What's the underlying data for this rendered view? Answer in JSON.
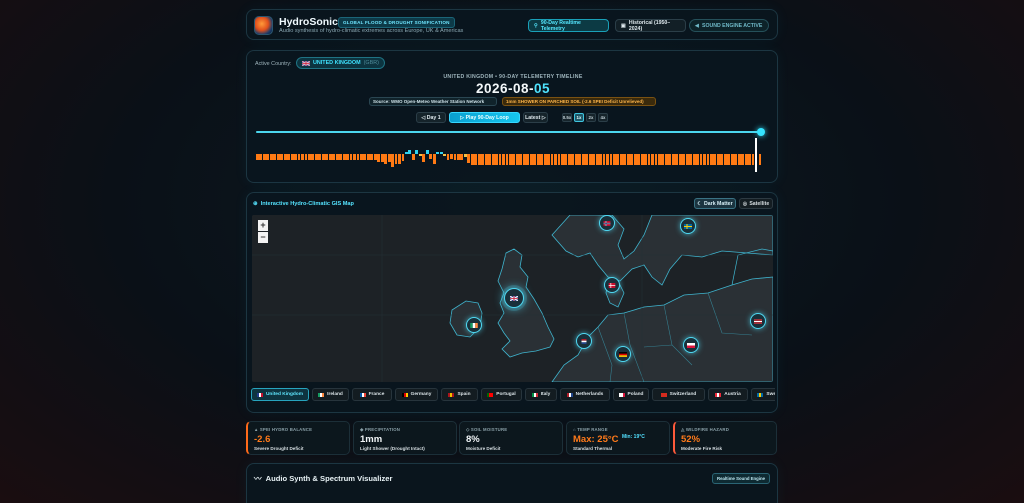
{
  "header": {
    "title": "HydroSonics",
    "badge": "GLOBAL FLOOD & DROUGHT SONIFICATION",
    "subtitle": "Audio synthesis of hydro-climatic extremes across Europe, UK & Americas",
    "btn_telemetry": "90-Day Realtime Telemetry",
    "btn_historical": "Historical (1950–2024)",
    "btn_sound": "SOUND ENGINE ACTIVE"
  },
  "timeline": {
    "active_label": "Active Country:",
    "active_country": "UNITED KINGDOM",
    "active_code": "(GBR)",
    "subtitle": "UNITED KINGDOM • 90-DAY TELEMETRY TIMELINE",
    "date_prefix": "2026-08-",
    "date_day": "05",
    "source": "Source: WMO Open-Meteo Weather Station Network",
    "status": "1mm SHOWER ON PARCHED SOIL (-2.6 SPEI Deficit Unrelieved)",
    "btn_day1": "Day 1",
    "btn_play": "Play 90-Day Loop",
    "btn_latest": "Latest",
    "speeds": [
      "0.5x",
      "1x",
      "2x",
      "4x"
    ],
    "active_speed": "1x",
    "position_fraction": 0.995,
    "bars": [
      -1,
      -1,
      -1,
      -1,
      -1,
      -1,
      -1,
      -1,
      -1,
      -1,
      -1,
      -1,
      -1,
      -1,
      -1,
      -1,
      -1,
      -1,
      -1,
      -1,
      -1,
      -1,
      -1,
      -1,
      -1,
      -1,
      -1,
      -1,
      -1,
      -1,
      -1,
      -1,
      -1,
      -1,
      -1,
      -1.4,
      -1.4,
      -1.6,
      -1.4,
      -2.2,
      -1.6,
      -1.6,
      -1.2,
      0.3,
      0.7,
      -1,
      0.6,
      -0.4,
      -1.4,
      0.6,
      -0.8,
      -1.6,
      0.2,
      0.2,
      -0.3,
      -1,
      -0.8,
      -1,
      -1,
      -1,
      -0.5,
      -1.5,
      -1.8,
      -1.8,
      -1.8,
      -1.8,
      -1.8,
      -1.8,
      -1.8,
      -1.8,
      -1.8,
      -1.8,
      -1.8,
      -1.8,
      -1.8,
      -1.8,
      -1.8,
      -1.8,
      -1.8,
      -1.8,
      -1.8,
      -1.8,
      -1.8,
      -1.8,
      -1.8,
      -1.8,
      -1.8,
      -1.8,
      -1.8,
      -1.8,
      -1.8,
      -1.8,
      -1.8,
      -1.8,
      -1.8,
      -1.8,
      -1.8,
      -1.8,
      -1.8,
      -1.8,
      -1.8,
      -1.8,
      -1.8,
      -1.8,
      -1.8,
      -1.8,
      -1.8,
      -1.8,
      -1.8,
      -1.8,
      -1.8,
      -1.8,
      -1.8,
      -1.8,
      -1.8,
      -1.8,
      -1.8,
      -1.8,
      -1.8,
      -1.8,
      -1.8,
      -1.8,
      -1.8,
      -1.8,
      -1.8,
      -1.8,
      -1.8,
      -1.8,
      -1.8,
      -1.8,
      -1.8,
      -1.8,
      -1.8,
      -1.8,
      -1.8,
      -1.8,
      -1.8,
      -1.8,
      -1.8,
      -1.8,
      -1.8,
      -1.8,
      -1.8,
      -1.8,
      -1.8,
      -1.8
    ],
    "colors": {
      "dry": "#ff7a14",
      "wet": "#2fd3f0",
      "partial": "#f4c045",
      "current": "#ffffff"
    }
  },
  "map": {
    "title": "Interactive Hydro-Climatic GIS Map",
    "btn_dark": "Dark Matter",
    "btn_sat": "Satellite",
    "zoom_in": "+",
    "zoom_out": "−"
  },
  "countries": [
    {
      "name": "United Kingdom",
      "active": true
    },
    {
      "name": "Ireland"
    },
    {
      "name": "France"
    },
    {
      "name": "Germany"
    },
    {
      "name": "Spain"
    },
    {
      "name": "Portugal"
    },
    {
      "name": "Italy"
    },
    {
      "name": "Netherlands"
    },
    {
      "name": "Poland"
    },
    {
      "name": "Switzerland"
    },
    {
      "name": "Austria"
    },
    {
      "name": "Sweden"
    }
  ],
  "stats": [
    {
      "label": "SPEI HYDRO BALANCE",
      "value": "-2.6",
      "sub": "Severe Drought Deficit",
      "color": "#ff7a1a"
    },
    {
      "label": "PRECIPITATION",
      "value": "1mm",
      "sub": "Light Shower (Drought Intact)",
      "color": "#f2f6f8"
    },
    {
      "label": "SOIL MOISTURE",
      "value": "8%",
      "sub": "Moisture Deficit",
      "color": "#f2f6f8"
    },
    {
      "label": "TEMP RANGE",
      "value": "Max: 25°C",
      "min": "Min: 19°C",
      "sub": "Standard Thermal",
      "color": "#ff7a1a"
    },
    {
      "label": "WILDFIRE HAZARD",
      "value": "52%",
      "sub": "Moderate Fire Risk",
      "color": "#ff7a1a"
    }
  ],
  "audio": {
    "title": "Audio Synth & Spectrum Visualizer",
    "badge": "Realtime Sound Engine"
  }
}
